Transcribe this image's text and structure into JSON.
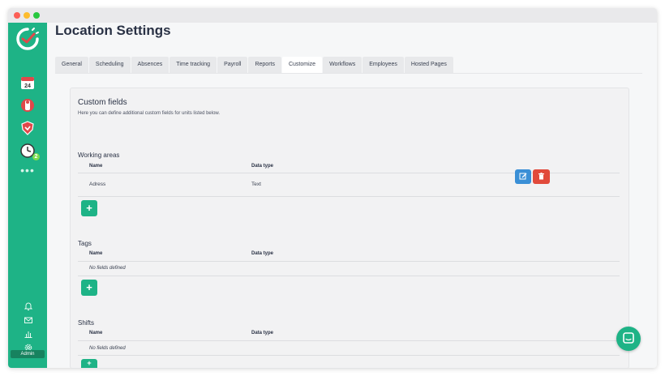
{
  "page": {
    "title": "Location Settings"
  },
  "tabs": [
    {
      "label": "General"
    },
    {
      "label": "Scheduling"
    },
    {
      "label": "Absences"
    },
    {
      "label": "Time tracking"
    },
    {
      "label": "Payroll"
    },
    {
      "label": "Reports"
    },
    {
      "label": "Customize",
      "active": true
    },
    {
      "label": "Workflows"
    },
    {
      "label": "Employees"
    },
    {
      "label": "Hosted Pages"
    }
  ],
  "sidebar": {
    "calendar_day": "24",
    "timeclock_badge": "2",
    "admin_label": "Admin"
  },
  "custom_fields": {
    "title": "Custom fields",
    "description": "Here you can define additional custom fields for units listed below.",
    "sections": [
      {
        "title": "Working areas",
        "col_name": "Name",
        "col_type": "Data type",
        "rows": [
          {
            "name": "Adress",
            "type": "Text"
          }
        ],
        "add_label": "+"
      },
      {
        "title": "Tags",
        "col_name": "Name",
        "col_type": "Data type",
        "empty_text": "No fields defined",
        "add_label": "+"
      },
      {
        "title": "Shifts",
        "col_name": "Name",
        "col_type": "Data type",
        "empty_text": "No fields defined",
        "add_label": "+"
      }
    ]
  },
  "colors": {
    "brand": "#1eb386",
    "edit": "#3a8fd6",
    "delete": "#e14a3b"
  }
}
